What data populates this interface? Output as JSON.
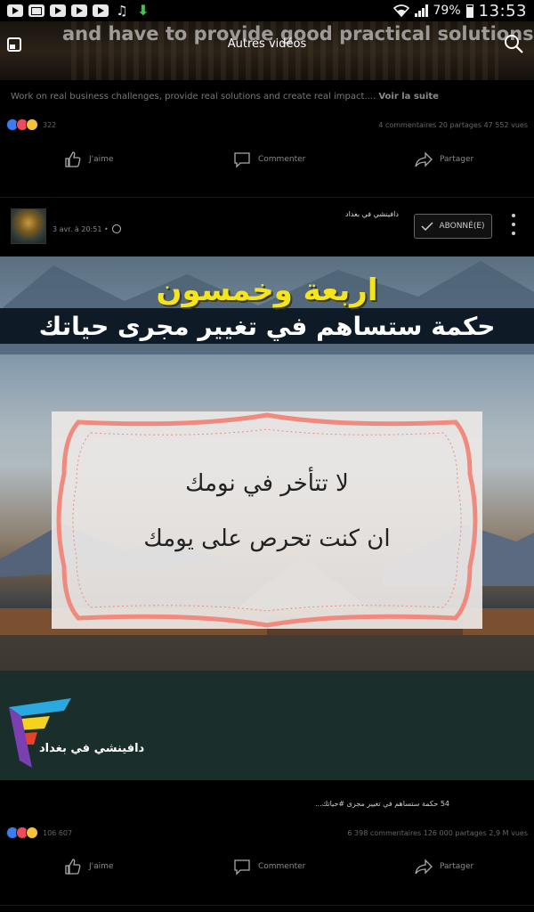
{
  "status_bar": {
    "battery": "79%",
    "time": "13:53",
    "icons": [
      "youtube-icon",
      "gmail-icon",
      "youtube-icon",
      "youtube-icon",
      "youtube-icon",
      "music-icon",
      "download-icon",
      "wifi-icon",
      "signal-icon",
      "battery-icon"
    ]
  },
  "top_video": {
    "caption": "and have to provide good practical solutions,",
    "label": "Autres vidéos"
  },
  "prev_post": {
    "description": "Work on real business challenges, provide real solutions and create real impact....",
    "see_more": "Voir la suite",
    "reaction_count": "322",
    "stats_right": "4 commentaires  20 partages  47 552 vues"
  },
  "actions": {
    "like": "J'aime",
    "comment": "Commenter",
    "share": "Partager"
  },
  "post": {
    "page_name": "دافينشي في بغداد",
    "date": "3 avr. à 20:51 •",
    "follow_label": "ABONNÉ(E)",
    "video": {
      "title_line1": "اربعة وخمسون",
      "title_line2": "حكمة ستساهم في تغيير مجرى حياتك",
      "quote_line1": "لا تتأخر في نومك",
      "quote_line2": "ان كنت تحرص على يومك",
      "logo_text": "دافينشي في بغداد"
    },
    "caption": "54 حكمة ستساهم في تغيير مجرى #حياتك...",
    "reaction_count": "106 607",
    "stats_right": "6 398 commentaires  126 000 partages  2,9 M vues"
  },
  "colors": {
    "background": "#000000",
    "title_yellow": "#f4e51d",
    "frame_pink": "#f08a7e",
    "like_blue": "#3b7cf5",
    "love_red": "#f04a61"
  }
}
